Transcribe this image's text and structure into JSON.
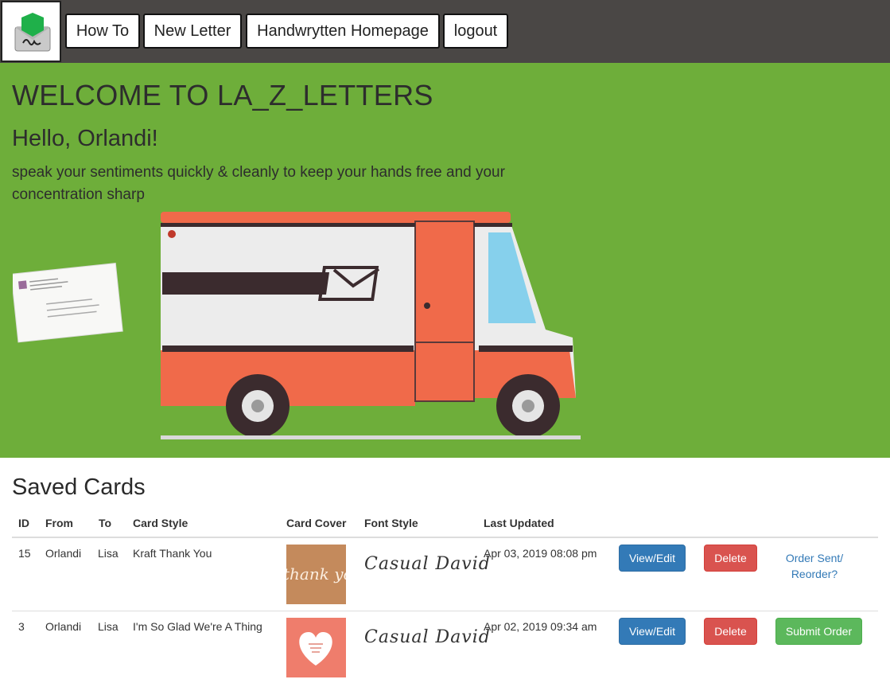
{
  "nav": {
    "items": [
      "How To",
      "New Letter",
      "Handwrytten Homepage",
      "logout"
    ]
  },
  "hero": {
    "title": "WELCOME TO LA_Z_LETTERS",
    "greeting": "Hello, Orlandi!",
    "tagline": "speak your sentiments quickly & cleanly to keep your hands free and your concentration sharp"
  },
  "saved": {
    "title": "Saved Cards",
    "columns": [
      "ID",
      "From",
      "To",
      "Card Style",
      "Card Cover",
      "Font Style",
      "Last Updated"
    ],
    "rows": [
      {
        "id": "15",
        "from": "Orlandi",
        "to": "Lisa",
        "style": "Kraft Thank You",
        "font": "Casual David",
        "updated": "Apr 03, 2019 08:08 pm",
        "view": "View/Edit",
        "delete": "Delete",
        "order_line1": "Order Sent/",
        "order_line2": "Reorder?"
      },
      {
        "id": "3",
        "from": "Orlandi",
        "to": "Lisa",
        "style": "I'm So Glad We're A Thing",
        "font": "Casual David",
        "updated": "Apr 02, 2019 09:34 am",
        "view": "View/Edit",
        "delete": "Delete",
        "submit": "Submit Order"
      }
    ]
  },
  "colors": {
    "nav_bg": "#4a4745",
    "hero_bg": "#6eae3a",
    "primary": "#337ab7",
    "danger": "#d9534f",
    "success": "#5cb85c"
  }
}
